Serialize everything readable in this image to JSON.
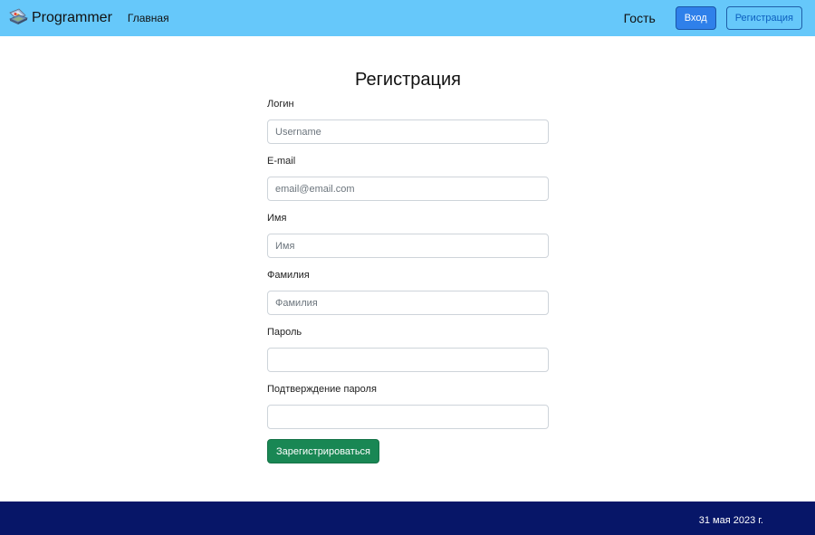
{
  "navbar": {
    "brand": "Programmer",
    "home_link": "Главная",
    "guest_label": "Гость",
    "login_button": "Вход",
    "register_button": "Регистрация",
    "background": "#66c8fa"
  },
  "form": {
    "title": "Регистрация",
    "fields": [
      {
        "label": "Логин",
        "placeholder": "Username",
        "type": "text"
      },
      {
        "label": "E-mail",
        "placeholder": "email@email.com",
        "type": "email"
      },
      {
        "label": "Имя",
        "placeholder": "Имя",
        "type": "text"
      },
      {
        "label": "Фамилия",
        "placeholder": "Фамилия",
        "type": "text"
      },
      {
        "label": "Пароль",
        "placeholder": "",
        "type": "password"
      },
      {
        "label": "Подтверждение пароля",
        "placeholder": "",
        "type": "password"
      }
    ],
    "submit_button": "Зарегистрироваться"
  },
  "footer": {
    "date": "31 мая 2023 г.",
    "background": "#071668"
  },
  "icons": {
    "brand_logo": "laptop-logo-icon"
  }
}
